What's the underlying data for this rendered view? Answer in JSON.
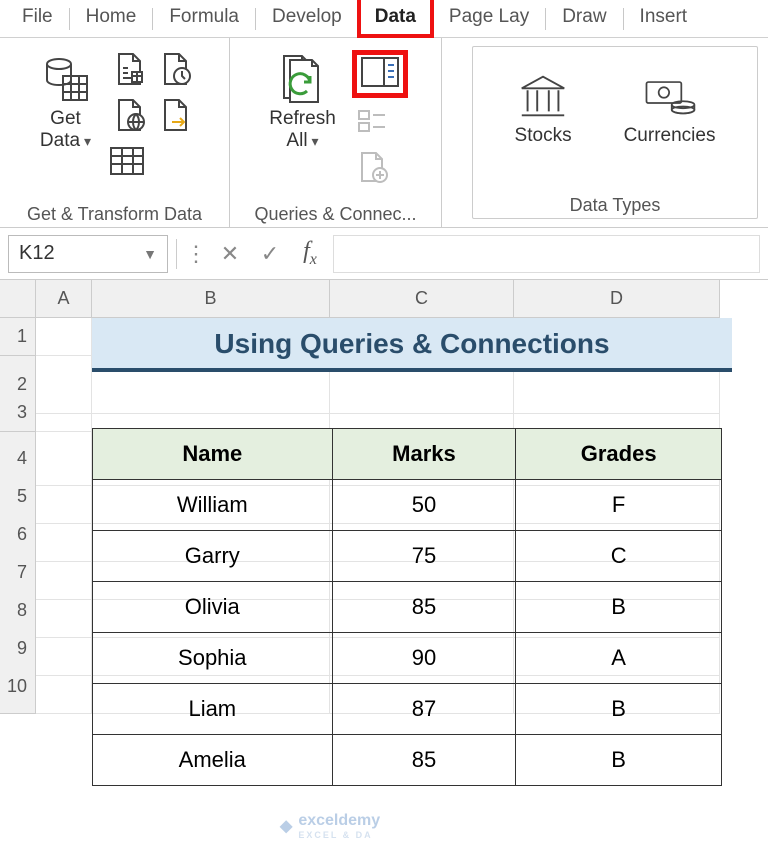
{
  "menu": {
    "tabs": [
      "File",
      "Home",
      "Formula",
      "Develop",
      "Data",
      "Page Lay",
      "Draw",
      "Insert"
    ],
    "active": "Data"
  },
  "ribbon": {
    "group1": {
      "title": "Get & Transform Data",
      "get_data": "Get\nData"
    },
    "group2": {
      "title": "Queries & Connec...",
      "refresh": "Refresh\nAll"
    },
    "group3": {
      "title": "Data Types",
      "stocks": "Stocks",
      "currencies": "Currencies"
    }
  },
  "formula_bar": {
    "cell_ref": "K12"
  },
  "columns": [
    "A",
    "B",
    "C",
    "D"
  ],
  "rows": [
    "1",
    "2",
    "3",
    "4",
    "5",
    "6",
    "7",
    "8",
    "9",
    "10"
  ],
  "sheet_title": "Using Queries & Connections",
  "table": {
    "headers": [
      "Name",
      "Marks",
      "Grades"
    ],
    "rows": [
      [
        "William",
        "50",
        "F"
      ],
      [
        "Garry",
        "75",
        "C"
      ],
      [
        "Olivia",
        "85",
        "B"
      ],
      [
        "Sophia",
        "90",
        "A"
      ],
      [
        "Liam",
        "87",
        "B"
      ],
      [
        "Amelia",
        "85",
        "B"
      ]
    ]
  },
  "watermark": {
    "brand": "exceldemy",
    "sub": "EXCEL & DA"
  }
}
